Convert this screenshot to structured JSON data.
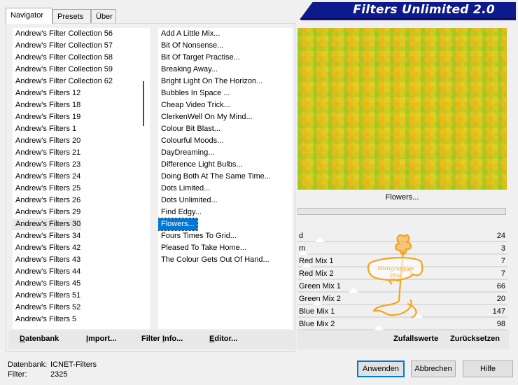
{
  "tabs": [
    {
      "label": "Navigator",
      "active": true
    },
    {
      "label": "Presets",
      "active": false
    },
    {
      "label": "Über",
      "active": false
    }
  ],
  "banner_title": "Filters Unlimited 2.0",
  "categories": [
    "Andrew's Filter Collection 56",
    "Andrew's Filter Collection 57",
    "Andrew's Filter Collection 58",
    "Andrew's Filter Collection 59",
    "Andrew's Filter Collection 62",
    "Andrew's Filters 12",
    "Andrew's Filters 18",
    "Andrew's Filters 19",
    "Andrew's Filters 1",
    "Andrew's Filters 20",
    "Andrew's Filters 21",
    "Andrew's Filters 23",
    "Andrew's Filters 24",
    "Andrew's Filters 25",
    "Andrew's Filters 26",
    "Andrew's Filters 29",
    "Andrew's Filters 30",
    "Andrew's Filters 34",
    "Andrew's Filters 42",
    "Andrew's Filters 43",
    "Andrew's Filters 44",
    "Andrew's Filters 45",
    "Andrew's Filters 51",
    "Andrew's Filters 52",
    "Andrew's Filters 5"
  ],
  "selected_category_index": 16,
  "filters": [
    "Add A Little Mix...",
    "Bit Of Nonsense...",
    "Bit Of Target Practise...",
    "Breaking Away...",
    "Bright Light On The Horizon...",
    "Bubbles In Space ...",
    "Cheap Video Trick...",
    "ClerkenWell On My Mind...",
    "Colour Bit Blast...",
    "Colourful Moods...",
    "DayDreaming...",
    "Difference Light Bulbs...",
    "Doing Both At The Same Time...",
    "Dots Limited...",
    "Dots Unlimited...",
    "Find Edgy...",
    "Flowers...",
    "Fours Times To Grid...",
    "Pleased To Take Home...",
    "The Colour Gets Out Of Hand..."
  ],
  "selected_filter_index": 16,
  "preview_filter_name": "Flowers...",
  "params": [
    {
      "label": "d",
      "value": "24",
      "level": 0.094
    },
    {
      "label": "m",
      "value": "3",
      "level": 0.012
    },
    {
      "label": "Red Mix 1",
      "value": "7",
      "level": 0.027
    },
    {
      "label": "Red Mix 2",
      "value": "7",
      "level": 0.027
    },
    {
      "label": "Green Mix 1",
      "value": "66",
      "level": 0.259
    },
    {
      "label": "Green Mix 2",
      "value": "20",
      "level": 0.078
    },
    {
      "label": "Blue Mix 1",
      "value": "147",
      "level": 0.576
    },
    {
      "label": "Blue Mix 2",
      "value": "98",
      "level": 0.384
    }
  ],
  "left_buttons": [
    {
      "label": "Datenbank",
      "underline": "D"
    },
    {
      "label": "Import...",
      "underline": "I"
    },
    {
      "label": "Filter Info...",
      "underline": "I"
    },
    {
      "label": "Editor...",
      "underline": "E"
    }
  ],
  "right_buttons": {
    "random": "Zufallswerte",
    "reset": "Zurücksetzen"
  },
  "status": {
    "db_label": "Datenbank:",
    "db_value": "ICNET-Filters",
    "filter_label": "Filter:",
    "filter_value": "2325"
  },
  "dialog_buttons": {
    "apply": "Anwenden",
    "cancel": "Abbrechen",
    "help": "Hilfe"
  },
  "watermark_text": "Mistigraphies Vina",
  "colors": {
    "banner": "#0c1a8c",
    "selection": "#0078d7",
    "watermark": "#f7a21b"
  }
}
